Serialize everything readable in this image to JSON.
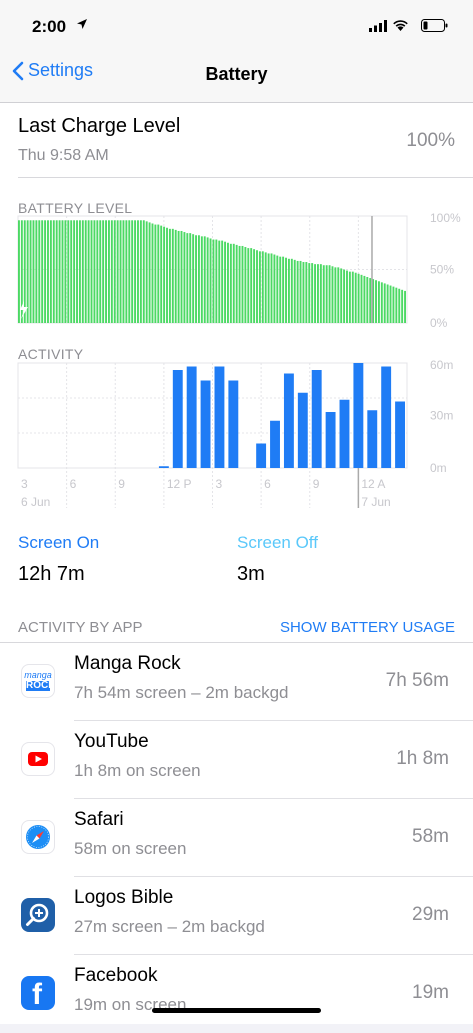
{
  "status_bar": {
    "time": "2:00"
  },
  "nav": {
    "back_label": "Settings",
    "title": "Battery"
  },
  "last_charge": {
    "title": "Last Charge Level",
    "subtitle": "Thu 9:58 AM",
    "value": "100%"
  },
  "colors": {
    "accent": "#1f7cf5",
    "battery_green": "#4cd964",
    "screen_off": "#5ac8fa"
  },
  "chart_data": [
    {
      "type": "bar",
      "title": "BATTERY LEVEL",
      "ylim": [
        0,
        100
      ],
      "y_tick_labels": [
        "100%",
        "50%",
        "0%"
      ],
      "charging_indicator": "bolt-icon",
      "values": [
        96,
        96,
        96,
        96,
        96,
        96,
        96,
        96,
        96,
        96,
        96,
        96,
        96,
        96,
        96,
        96,
        96,
        96,
        96,
        96,
        96,
        96,
        96,
        96,
        96,
        96,
        96,
        96,
        96,
        96,
        96,
        96,
        96,
        96,
        96,
        96,
        96,
        96,
        96,
        96,
        96,
        96,
        96,
        96,
        95,
        94,
        93,
        92,
        92,
        91,
        90,
        89,
        88,
        88,
        87,
        86,
        86,
        85,
        84,
        84,
        83,
        82,
        82,
        81,
        81,
        80,
        79,
        78,
        78,
        77,
        77,
        76,
        75,
        74,
        74,
        73,
        72,
        72,
        71,
        70,
        70,
        69,
        68,
        67,
        67,
        66,
        65,
        65,
        64,
        63,
        62,
        62,
        61,
        60,
        60,
        59,
        58,
        58,
        57,
        57,
        56,
        56,
        55,
        55,
        55,
        54,
        54,
        54,
        53,
        52,
        52,
        51,
        50,
        49,
        48,
        48,
        47,
        46,
        45,
        44,
        43,
        42,
        41,
        40,
        39,
        38,
        37,
        36,
        35,
        34,
        33,
        32,
        31,
        30
      ]
    },
    {
      "type": "bar",
      "title": "ACTIVITY",
      "ylim": [
        0,
        60
      ],
      "y_tick_labels": [
        "60m",
        "30m",
        "0m"
      ],
      "x_tick_labels": [
        "3",
        "6",
        "9",
        "12 P",
        "3",
        "6",
        "9",
        "12 A"
      ],
      "date_labels": [
        "6 Jun",
        "7 Jun"
      ],
      "series": [
        {
          "name": "Screen On",
          "values": [
            0,
            0,
            0,
            0,
            0,
            0,
            0,
            0,
            0,
            0,
            1,
            56,
            58,
            50,
            58,
            50,
            0,
            14,
            27,
            54,
            43,
            56,
            32,
            39,
            60,
            33,
            58,
            38
          ]
        }
      ]
    }
  ],
  "usage": {
    "screen_on_label": "Screen On",
    "screen_on_value": "12h 7m",
    "screen_off_label": "Screen Off",
    "screen_off_value": "3m"
  },
  "activity_by_app": {
    "label": "ACTIVITY BY APP",
    "show_button": "SHOW BATTERY USAGE",
    "apps": [
      {
        "name": "Manga Rock",
        "detail": "7h 54m screen – 2m backgd",
        "time": "7h 56m",
        "icon": "manga-rock-icon",
        "icon_text_1": "manga",
        "icon_text_2": "ROCK"
      },
      {
        "name": "YouTube",
        "detail": "1h 8m on screen",
        "time": "1h 8m",
        "icon": "youtube-icon"
      },
      {
        "name": "Safari",
        "detail": "58m on screen",
        "time": "58m",
        "icon": "safari-icon"
      },
      {
        "name": "Logos Bible",
        "detail": "27m screen – 2m backgd",
        "time": "29m",
        "icon": "logos-bible-icon"
      },
      {
        "name": "Facebook",
        "detail": "19m on screen",
        "time": "19m",
        "icon": "facebook-icon",
        "icon_text_1": "f"
      }
    ]
  }
}
